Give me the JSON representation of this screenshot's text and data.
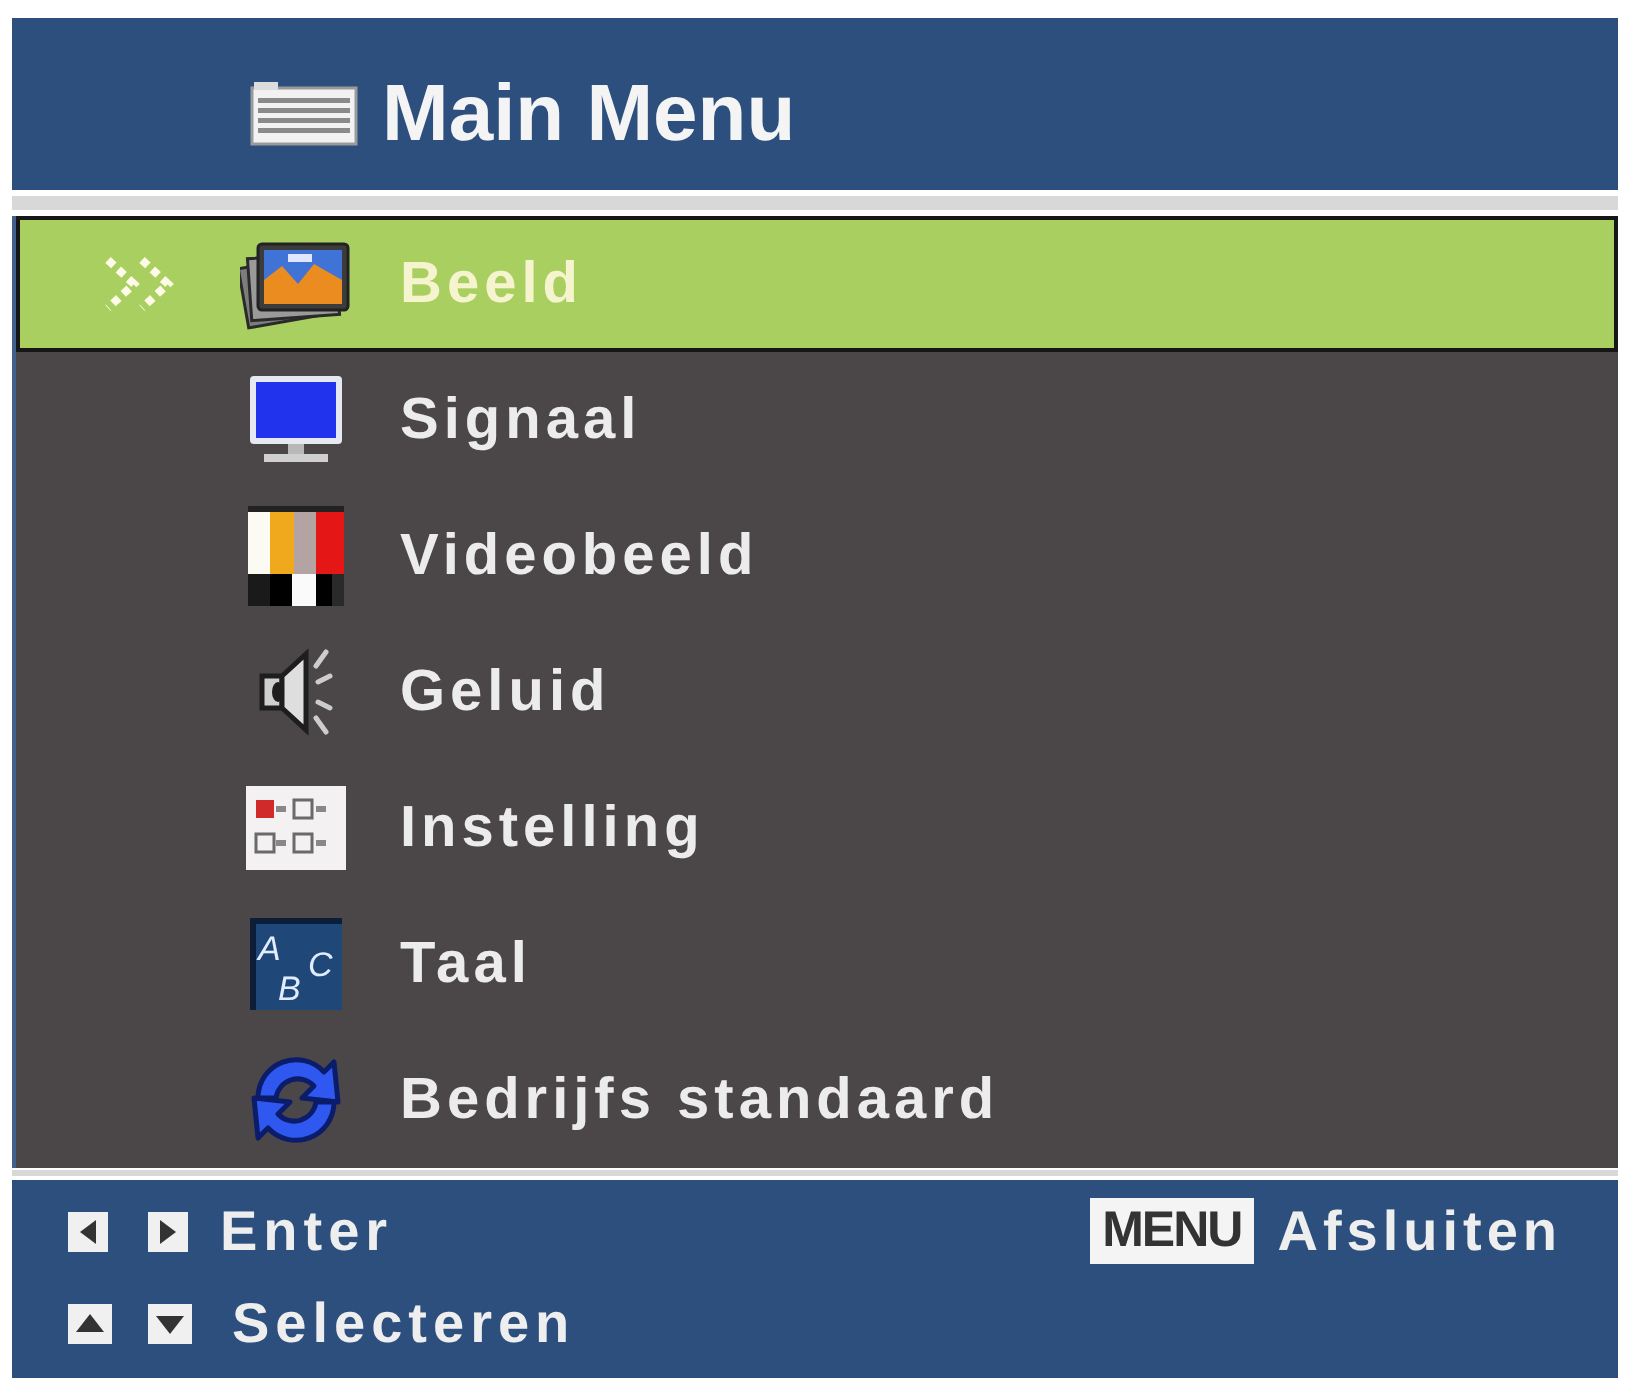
{
  "window": {
    "title": "Main Menu"
  },
  "menu": {
    "items": [
      {
        "label": "Beeld",
        "selected": true
      },
      {
        "label": "Signaal",
        "selected": false
      },
      {
        "label": "Videobeeld",
        "selected": false
      },
      {
        "label": "Geluid",
        "selected": false
      },
      {
        "label": "Instelling",
        "selected": false
      },
      {
        "label": "Taal",
        "selected": false,
        "icon_letters": [
          "A",
          "B",
          "C"
        ]
      },
      {
        "label": "Bedrijfs standaard",
        "selected": false
      }
    ]
  },
  "footer": {
    "enter": {
      "label": "Enter"
    },
    "exit": {
      "key": "MENU",
      "label": "Afsluiten"
    },
    "select": {
      "label": "Selecteren"
    }
  }
}
